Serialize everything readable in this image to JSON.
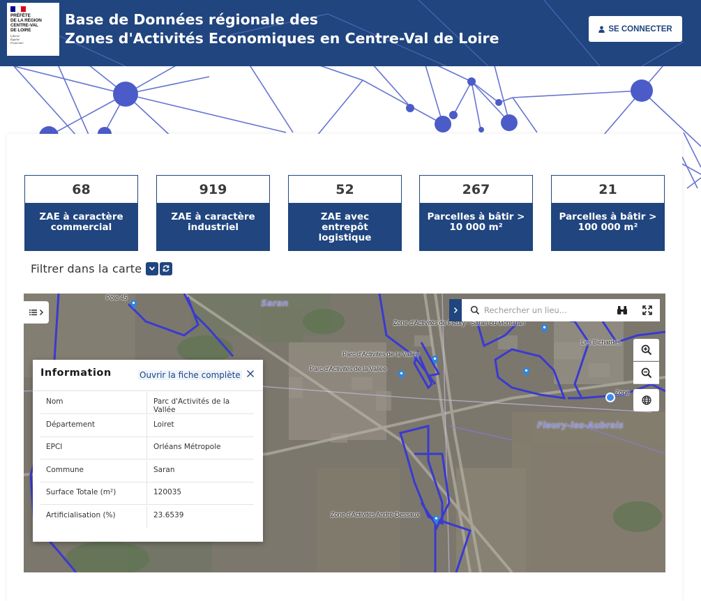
{
  "header": {
    "logo": {
      "text_lines": [
        "PRÉFÈTE",
        "DE LA RÉGION",
        "CENTRE-VAL",
        "DE LOIRE"
      ],
      "motto_lines": [
        "Liberté",
        "Égalité",
        "Fraternité"
      ],
      "flag_colors": [
        "#000091",
        "#ffffff",
        "#e1000f"
      ]
    },
    "title_line1": "Base de Données régionale des",
    "title_line2": "Zones d'Activités Economiques en Centre-Val de Loire",
    "connect_label": "SE CONNECTER",
    "connect_icon": "user-icon"
  },
  "stats": [
    {
      "value": "68",
      "label_lines": [
        "ZAE à caractère",
        "commercial"
      ]
    },
    {
      "value": "919",
      "label_lines": [
        "ZAE à caractère",
        "industriel"
      ]
    },
    {
      "value": "52",
      "label_lines": [
        "ZAE avec",
        "entrepôt",
        "logistique"
      ]
    },
    {
      "value": "267",
      "label_lines": [
        "Parcelles à bâtir >",
        "10 000 m²"
      ]
    },
    {
      "value": "21",
      "label_lines": [
        "Parcelles à bâtir >",
        "100 000 m²"
      ]
    }
  ],
  "filter": {
    "label": "Filtrer dans la carte",
    "toggle_icon": "chevron-down-icon",
    "reset_icon": "refresh-icon"
  },
  "map": {
    "search_placeholder": "Rechercher un lieu...",
    "place_labels": [
      "Saran",
      "Fleury-les-Aubrais"
    ],
    "zone_labels": [
      "Pôle 45",
      "Zone d'Activités de Fleury - Saran ou Montaran",
      "Parc d'Activités de la Vallée",
      "Parc d'Activités de la Vallée",
      "Les Bichardes",
      "Zone",
      "Zone d'Activités André-Dessaux"
    ],
    "controls": [
      "layers-icon",
      "binoculars-icon",
      "fullscreen-icon",
      "zoom-in-icon",
      "zoom-out-icon",
      "globe-icon"
    ],
    "boundary_color": "#3a3ad0",
    "pin_color": "#2e86de"
  },
  "info": {
    "title": "Information",
    "open_link": "Ouvrir la fiche complète",
    "rows": [
      {
        "key": "Nom",
        "value": "Parc d'Activités de la Vallée"
      },
      {
        "key": "Département",
        "value": "Loiret"
      },
      {
        "key": "EPCI",
        "value": "Orléans Métropole"
      },
      {
        "key": "Commune",
        "value": "Saran"
      },
      {
        "key": "Surface Totale (m²)",
        "value": "120035"
      },
      {
        "key": "Artificialisation (%)",
        "value": "23.6539"
      }
    ]
  },
  "theme": {
    "primary": "#20457f",
    "network": "#4b5cc9"
  }
}
